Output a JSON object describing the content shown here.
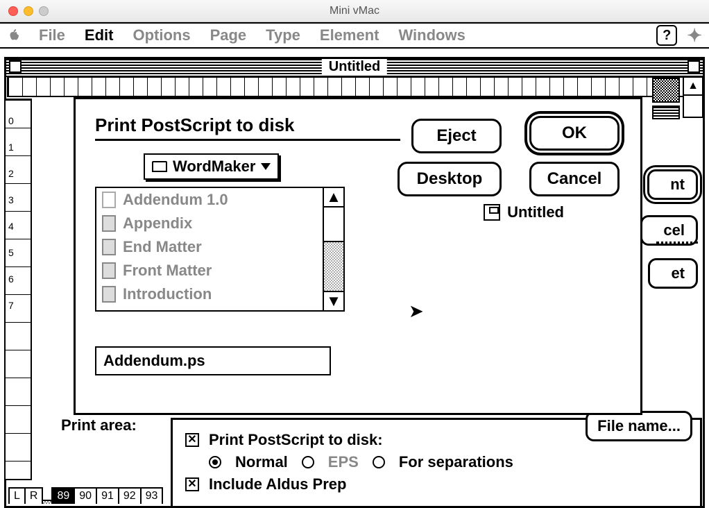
{
  "host": {
    "title": "Mini vMac"
  },
  "menubar": {
    "items": [
      "File",
      "Edit",
      "Options",
      "Page",
      "Type",
      "Element",
      "Windows"
    ],
    "active_index": 1
  },
  "doc_window": {
    "title": "Untitled"
  },
  "dialog": {
    "title": "Print PostScript to disk",
    "folder": "WordMaker",
    "files": [
      "Addendum 1.0",
      "Appendix",
      "End Matter",
      "Front Matter",
      "Introduction"
    ],
    "filename_value": "Addendum.ps",
    "buttons": {
      "ok": "OK",
      "cancel": "Cancel",
      "eject": "Eject",
      "desktop": "Desktop"
    },
    "disk_name": "Untitled"
  },
  "options": {
    "print_area_label": "Print area:",
    "print_ps_label": "Print PostScript to disk:",
    "print_ps_checked": true,
    "mode_labels": {
      "normal": "Normal",
      "eps": "EPS",
      "separations": "For separations"
    },
    "mode_selected": "normal",
    "include_prep_label": "Include Aldus Prep",
    "include_prep_checked": true,
    "file_name_button": "File name..."
  },
  "ruler_left_numbers": [
    "0",
    "1",
    "2",
    "3",
    "4",
    "5",
    "6",
    "7"
  ],
  "page_tabs": [
    "L",
    "R",
    "",
    "89",
    "90",
    "91",
    "92",
    "93"
  ],
  "peek_buttons": {
    "nt": "nt",
    "cel": "cel",
    "et": "et"
  }
}
